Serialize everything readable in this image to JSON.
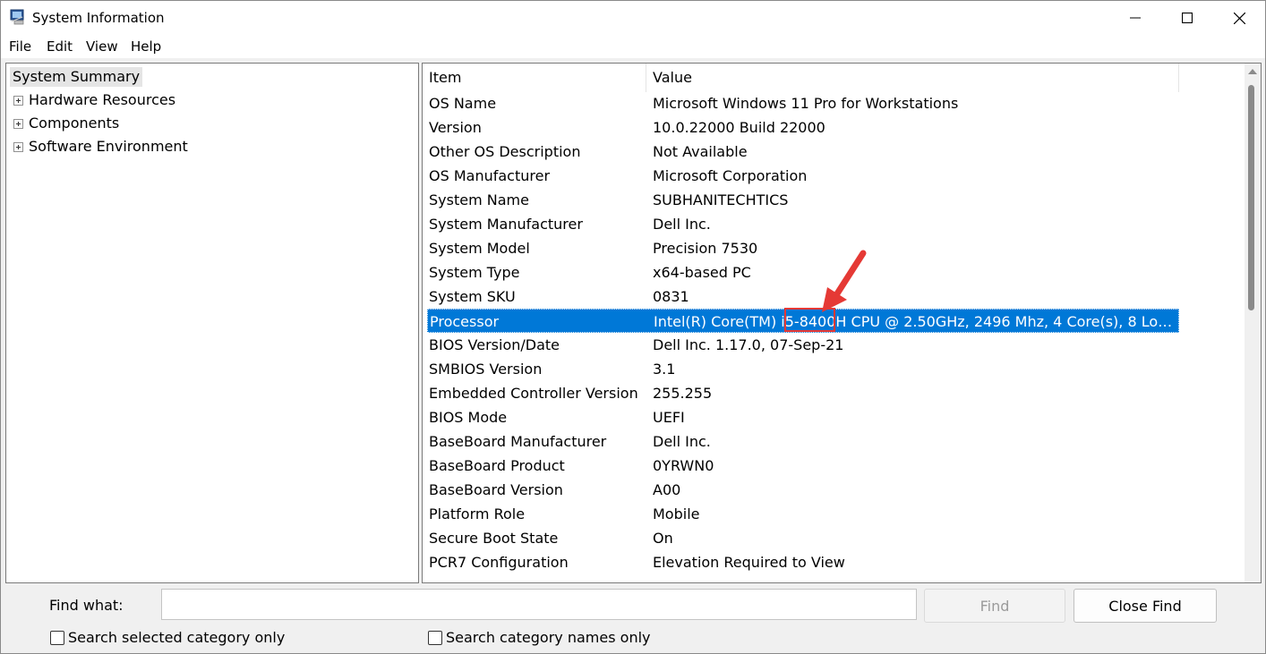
{
  "window": {
    "title": "System Information",
    "controls": {
      "minimize": "minimize-icon",
      "maximize": "maximize-icon",
      "close": "close-icon"
    }
  },
  "menu": {
    "file": "File",
    "edit": "Edit",
    "view": "View",
    "help": "Help"
  },
  "tree": {
    "root": "System Summary",
    "children": [
      "Hardware Resources",
      "Components",
      "Software Environment"
    ]
  },
  "table": {
    "headers": {
      "item": "Item",
      "value": "Value"
    },
    "rows": [
      {
        "item": "OS Name",
        "value": "Microsoft Windows 11 Pro for Workstations"
      },
      {
        "item": "Version",
        "value": "10.0.22000 Build 22000"
      },
      {
        "item": "Other OS Description",
        "value": "Not Available"
      },
      {
        "item": "OS Manufacturer",
        "value": "Microsoft Corporation"
      },
      {
        "item": "System Name",
        "value": "SUBHANITECHTICS"
      },
      {
        "item": "System Manufacturer",
        "value": "Dell Inc."
      },
      {
        "item": "System Model",
        "value": "Precision 7530"
      },
      {
        "item": "System Type",
        "value": "x64-based PC"
      },
      {
        "item": "System SKU",
        "value": "0831"
      },
      {
        "item": "Processor",
        "value": "Intel(R) Core(TM) i5-8400H CPU @ 2.50GHz, 2496 Mhz, 4 Core(s), 8 Logical ..."
      },
      {
        "item": "BIOS Version/Date",
        "value": "Dell Inc. 1.17.0, 07-Sep-21"
      },
      {
        "item": "SMBIOS Version",
        "value": "3.1"
      },
      {
        "item": "Embedded Controller Version",
        "value": "255.255"
      },
      {
        "item": "BIOS Mode",
        "value": "UEFI"
      },
      {
        "item": "BaseBoard Manufacturer",
        "value": "Dell Inc."
      },
      {
        "item": "BaseBoard Product",
        "value": "0YRWN0"
      },
      {
        "item": "BaseBoard Version",
        "value": "A00"
      },
      {
        "item": "Platform Role",
        "value": "Mobile"
      },
      {
        "item": "Secure Boot State",
        "value": "On"
      },
      {
        "item": "PCR7 Configuration",
        "value": "Elevation Required to View"
      }
    ],
    "selected_row": "Processor"
  },
  "find": {
    "label": "Find what:",
    "value": "",
    "find_button": "Find",
    "close_button": "Close Find",
    "check_selected": "Search selected category only",
    "check_names": "Search category names only"
  },
  "colors": {
    "selection": "#0078d7",
    "annotation": "#e53935"
  }
}
